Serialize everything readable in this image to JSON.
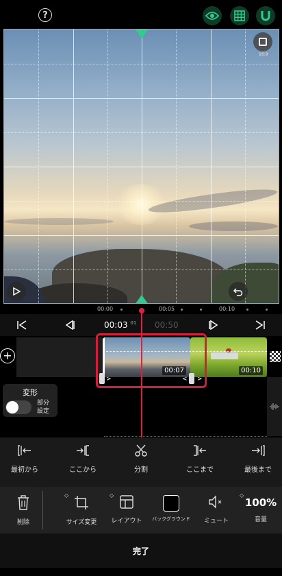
{
  "header": {
    "help_icon": "question-circle-icon",
    "buttons": [
      {
        "name": "preview-eye-button",
        "icon": "eye-icon"
      },
      {
        "name": "grid-toggle-button",
        "icon": "grid-icon"
      },
      {
        "name": "snap-magnet-button",
        "icon": "magnet-icon"
      }
    ],
    "accent_color": "#2ecc8f"
  },
  "preview": {
    "aspect_badge": "16:9"
  },
  "ruler": {
    "labels": [
      "00:00",
      "00:05",
      "00:10"
    ]
  },
  "transport": {
    "current_time": "00:03",
    "current_frame": "01",
    "total_time": "00:50"
  },
  "clips": [
    {
      "duration": "00:07"
    },
    {
      "duration": "00:10"
    }
  ],
  "transform_panel": {
    "title": "変形",
    "partial_setting": "部分\n設定"
  },
  "edit_tools": [
    {
      "label": "最初から",
      "icon": "trim-from-start-icon"
    },
    {
      "label": "ここから",
      "icon": "trim-here-right-icon"
    },
    {
      "label": "分割",
      "icon": "scissors-icon"
    },
    {
      "label": "ここまで",
      "icon": "trim-here-left-icon"
    },
    {
      "label": "最後まで",
      "icon": "trim-to-end-icon"
    }
  ],
  "bottom_tools": {
    "delete": "削除",
    "resize": "サイズ変更",
    "layout": "レイアウト",
    "background": "バックグラウンド",
    "mute": "ミュート",
    "volume_value": "100%",
    "volume": "音量"
  },
  "done_label": "完了",
  "selection_color": "#d21f3c"
}
